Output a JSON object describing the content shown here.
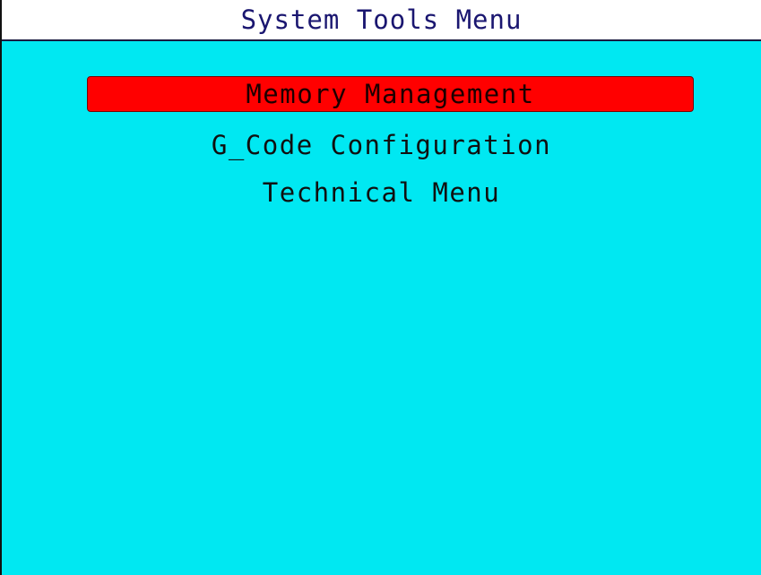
{
  "header": {
    "title": "System Tools Menu"
  },
  "menu": {
    "items": [
      {
        "label": "Memory Management",
        "selected": true
      },
      {
        "label": "G_Code Configuration",
        "selected": false
      },
      {
        "label": "Technical Menu",
        "selected": false
      }
    ]
  },
  "colors": {
    "background": "#00e8f2",
    "highlight": "#ff0000",
    "title_text": "#1a1670",
    "item_text": "#101010"
  }
}
